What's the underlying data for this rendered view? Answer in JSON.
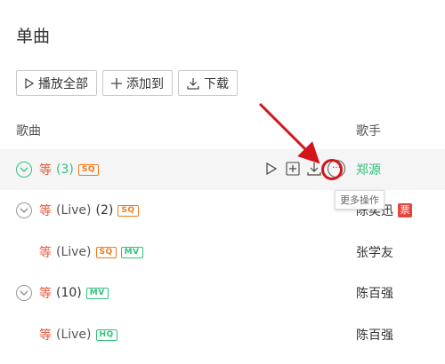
{
  "page": {
    "title": "单曲"
  },
  "toolbar": {
    "play_all": "播放全部",
    "add_to": "添加到",
    "download": "下载"
  },
  "header": {
    "song": "歌曲",
    "singer": "歌手"
  },
  "rows": [
    {
      "name": "等",
      "extra": "",
      "count": "(3)",
      "tags": [
        "SQ"
      ],
      "singer": "郑源",
      "badge": ""
    },
    {
      "name": "等",
      "extra": "(Live)",
      "count": "(2)",
      "tags": [
        "SQ"
      ],
      "singer": "陈奕迅",
      "badge": "票"
    },
    {
      "name": "等",
      "extra": "(Live)",
      "count": "",
      "tags": [
        "SQ",
        "MV"
      ],
      "singer": "张学友",
      "badge": ""
    },
    {
      "name": "等",
      "extra": "",
      "count": "(10)",
      "tags": [
        "MV"
      ],
      "singer": "陈百强",
      "badge": ""
    },
    {
      "name": "等",
      "extra": "(Live)",
      "count": "",
      "tags": [
        "HQ"
      ],
      "singer": "陈百强",
      "badge": ""
    }
  ],
  "tooltip": "更多操作",
  "more_glyph": "···",
  "colors": {
    "accent": "#31c27c",
    "song_red": "#e4573b",
    "sq_orange": "#f07b1a",
    "annotation_red": "#d2141b"
  }
}
